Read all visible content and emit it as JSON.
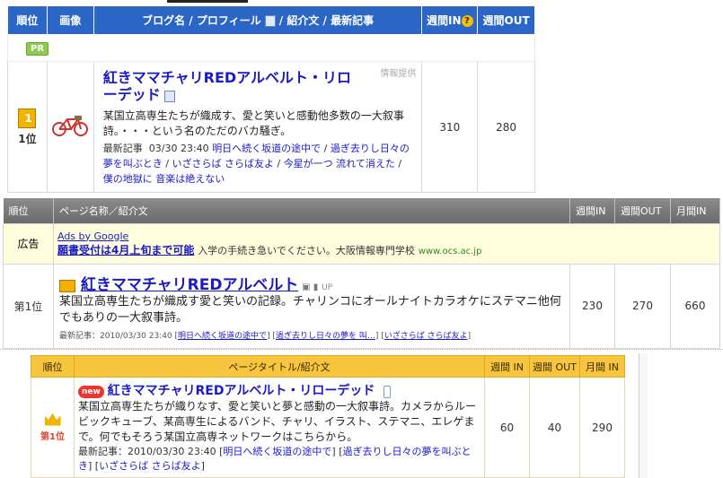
{
  "panel1": {
    "headers": [
      "順位",
      "画像",
      "ブログ名 / プロフィール",
      "/ 紹介文 / 最新記事",
      "週間IN",
      "週間OUT"
    ],
    "help_icon": "?",
    "pr_label": "PR",
    "row": {
      "rank": "1位",
      "title": "紅きママチャリREDアルベルト・リローデッド",
      "info_label": "情報提供",
      "description": "某国立高専生たちが織成す、愛と笑いと感動他多数の一大叙事詩。・・・という名のただのバカ騒ぎ。",
      "latest_label": "最新記事",
      "latest_date": "03/30 23:40",
      "latest_links": [
        "明日へ続く坂道の途中で",
        "過ぎ去りし日々の夢を叫ぶとき",
        "いざさらば さらば友よ",
        "今星が一つ 流れて消えた",
        "僕の地獄に 音楽は絶えない"
      ],
      "weekly_in": "310",
      "weekly_out": "280"
    }
  },
  "panel2": {
    "headers": [
      "順位",
      "ページ名称／紹介文",
      "週間IN",
      "週間OUT",
      "月間IN"
    ],
    "ad": {
      "label": "広告",
      "ads_by": "Ads by Google",
      "title": "願書受付は4月上旬まで可能",
      "text": "入学の手続き急いでください。大阪情報専門学校",
      "url": "www.ocs.ac.jp"
    },
    "row": {
      "rank": "第1位",
      "title": "紅きママチャリREDアルベルト",
      "badge": "UP",
      "description": "某国立高専生たちが織成す愛と笑いの記録。チャリンコにオールナイトカラオケにステマニ他何でもありの一大叙事詩。",
      "latest_label": "最新記事：2010/03/30 23:40",
      "latest_links": [
        "明日へ続く坂道の途中で",
        "過ぎ去りし日々の夢を 叫…",
        "いざさらば さらば友よ"
      ],
      "weekly_in": "230",
      "weekly_out": "270",
      "monthly_in": "660"
    }
  },
  "panel3": {
    "headers": [
      "順位",
      "ページタイトル/紹介文",
      "週間 IN",
      "週間 OUT",
      "月間 IN"
    ],
    "row": {
      "rank": "第1位",
      "new_badge": "new",
      "title": "紅きママチャリREDアルベルト・リローデッド",
      "description": "某国立高専生たちが織りなす、愛と笑いと夢と感動の一大叙事詩。カメラからルービックキューブ、某高専生によるバンド、チャリ、イラスト、ステマニ、エレゲまで。何でもそろう某国立高専ネットワークはこちらから。",
      "latest_label": "最新記事：2010/03/30 23:40",
      "latest_links": [
        "明日へ続く坂道の途中で",
        "過ぎ去りし日々の夢を叫ぶとき",
        "いざさらば さらば友よ"
      ],
      "weekly_in": "60",
      "weekly_out": "40",
      "monthly_in": "290"
    }
  }
}
